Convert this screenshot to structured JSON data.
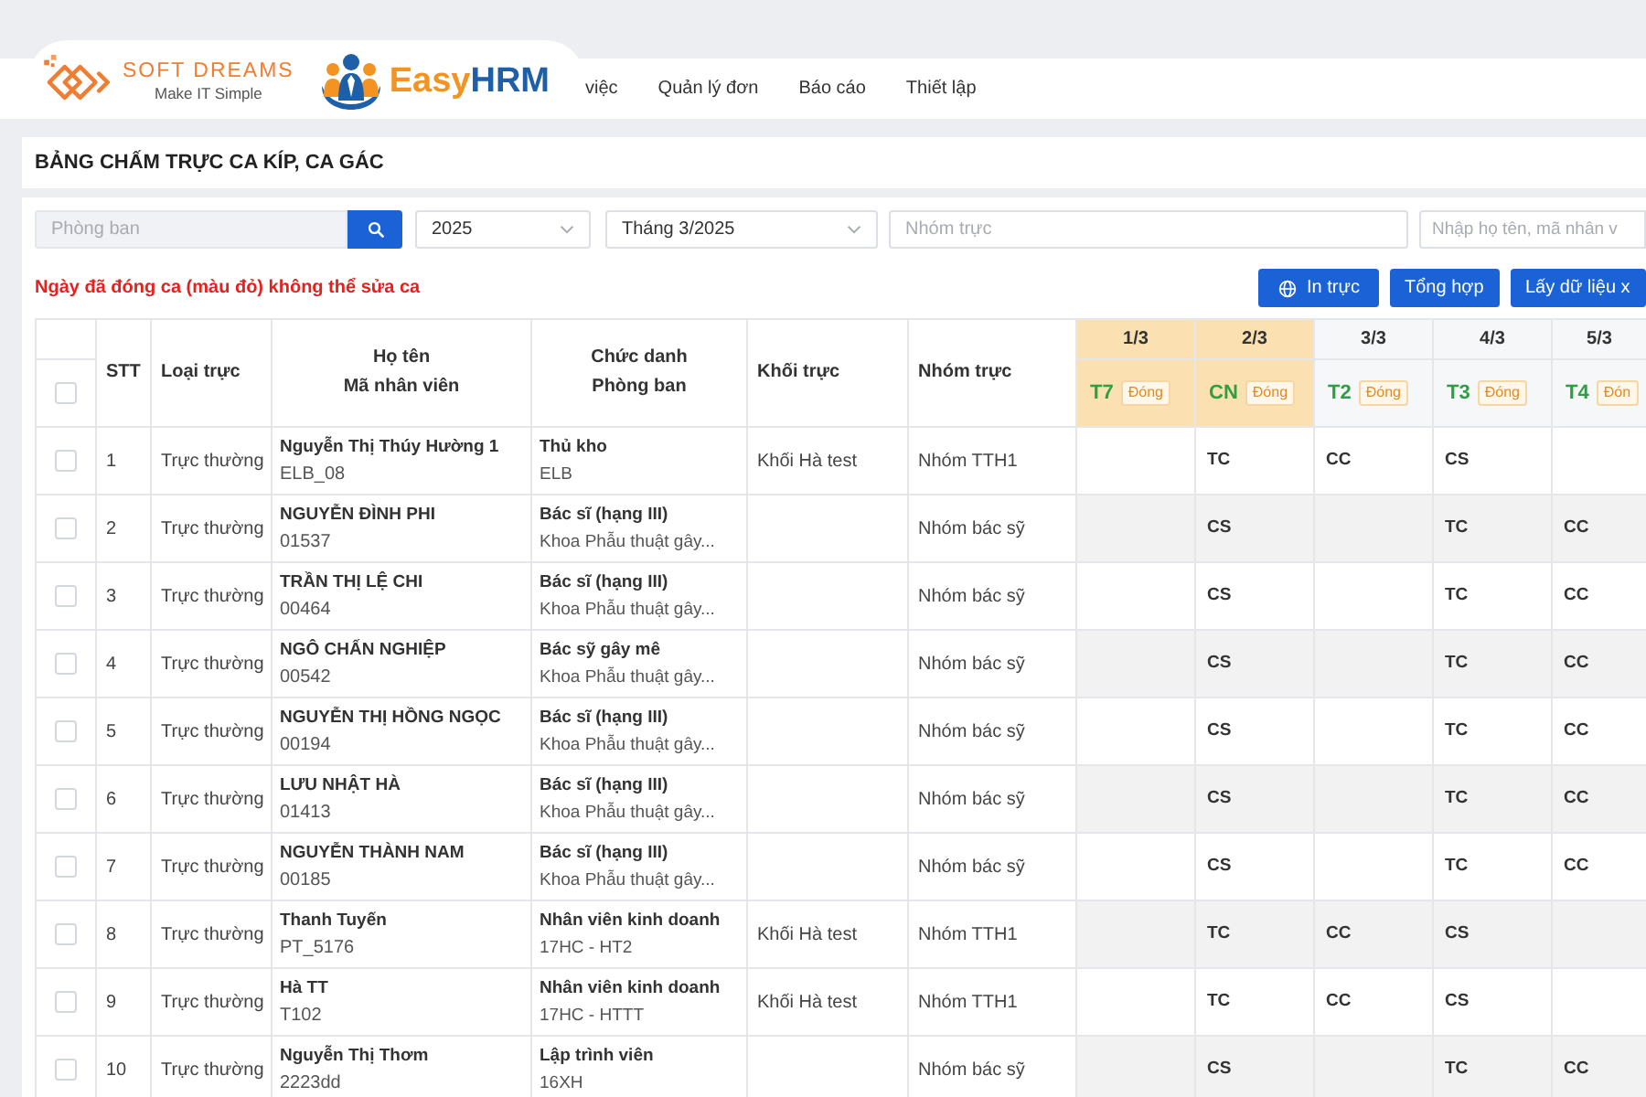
{
  "logos": {
    "company": {
      "name": "SOFT DREAMS",
      "tagline": "Make IT Simple"
    },
    "product": {
      "name_lead": "Easy",
      "name_tail": "HRM"
    }
  },
  "nav": {
    "items": [
      "việc",
      "Quản lý đơn",
      "Báo cáo",
      "Thiết lập"
    ]
  },
  "page_title": "BẢNG CHẤM TRỰC CA KÍP, CA GÁC",
  "filters": {
    "department": {
      "placeholder": "Phòng ban"
    },
    "year": {
      "value": "2025"
    },
    "month": {
      "value": "Tháng 3/2025"
    },
    "duty_group": {
      "placeholder": "Nhóm trực"
    },
    "search": {
      "placeholder": "Nhập họ tên, mã nhân v"
    }
  },
  "notice": "Ngày đã đóng ca (màu đỏ) không thể sửa ca",
  "actions": [
    {
      "kind": "icon",
      "label": "In trực"
    },
    {
      "kind": "text",
      "label": "Tổng hợp"
    },
    {
      "kind": "text",
      "label": "Lấy dữ liệu x"
    }
  ],
  "table": {
    "select_all": {
      "checked": false
    },
    "columns": [
      {
        "lines": [
          "STT"
        ]
      },
      {
        "lines": [
          "Loại trực"
        ]
      },
      {
        "lines": [
          "Họ tên",
          "Mã nhân viên"
        ]
      },
      {
        "lines": [
          "Chức danh",
          "Phòng ban"
        ]
      },
      {
        "lines": [
          "Khối trực"
        ]
      },
      {
        "lines": [
          "Nhóm trực"
        ]
      }
    ],
    "days": [
      {
        "date": "1/3",
        "weekday": "T7",
        "status": "Đóng",
        "weekend": true
      },
      {
        "date": "2/3",
        "weekday": "CN",
        "status": "Đóng",
        "weekend": true
      },
      {
        "date": "3/3",
        "weekday": "T2",
        "status": "Đóng",
        "weekend": false
      },
      {
        "date": "4/3",
        "weekday": "T3",
        "status": "Đóng",
        "weekend": false
      },
      {
        "date": "5/3",
        "weekday": "T4",
        "status": "Đón",
        "weekend": false
      }
    ],
    "rows": [
      {
        "checked": false,
        "stt": "1",
        "type": "Trực thường",
        "name": "Nguyễn Thị Thúy Hường 1",
        "code": "ELB_08",
        "title": "Thủ kho",
        "department": "ELB",
        "block": "Khối Hà test",
        "group": "Nhóm TTH1",
        "shifts": {
          "day_2": "TC",
          "day_3": "CC",
          "day_4": "CS"
        }
      },
      {
        "checked": false,
        "stt": "2",
        "type": "Trực thường",
        "name": "NGUYỄN ĐÌNH PHI",
        "code": "01537",
        "title": "Bác sĩ (hạng III)",
        "department": "Khoa Phẫu thuật gây...",
        "group": "Nhóm bác sỹ",
        "shifts": {
          "day_2": "CS",
          "day_4": "TC",
          "day_5": "CC"
        }
      },
      {
        "checked": false,
        "stt": "3",
        "type": "Trực thường",
        "name": "TRẦN THỊ LỆ CHI",
        "code": "00464",
        "title": "Bác sĩ (hạng III)",
        "department": "Khoa Phẫu thuật gây...",
        "group": "Nhóm bác sỹ",
        "shifts": {
          "day_2": "CS",
          "day_4": "TC",
          "day_5": "CC"
        }
      },
      {
        "checked": false,
        "stt": "4",
        "type": "Trực thường",
        "name": "NGÔ CHẤN NGHIỆP",
        "code": "00542",
        "title": "Bác sỹ gây mê",
        "department": "Khoa Phẫu thuật gây...",
        "group": "Nhóm bác sỹ",
        "shifts": {
          "day_2": "CS",
          "day_4": "TC",
          "day_5": "CC"
        }
      },
      {
        "checked": false,
        "stt": "5",
        "type": "Trực thường",
        "name": "NGUYỄN THỊ HỒNG NGỌC",
        "code": "00194",
        "title": "Bác sĩ (hạng III)",
        "department": "Khoa Phẫu thuật gây...",
        "group": "Nhóm bác sỹ",
        "shifts": {
          "day_2": "CS",
          "day_4": "TC",
          "day_5": "CC"
        }
      },
      {
        "checked": false,
        "stt": "6",
        "type": "Trực thường",
        "name": "LƯU NHẬT HÀ",
        "code": "01413",
        "title": "Bác sĩ (hạng III)",
        "department": "Khoa Phẫu thuật gây...",
        "group": "Nhóm bác sỹ",
        "shifts": {
          "day_2": "CS",
          "day_4": "TC",
          "day_5": "CC"
        }
      },
      {
        "checked": false,
        "stt": "7",
        "type": "Trực thường",
        "name": "NGUYỄN THÀNH NAM",
        "code": "00185",
        "title": "Bác sĩ (hạng III)",
        "department": "Khoa Phẫu thuật gây...",
        "group": "Nhóm bác sỹ",
        "shifts": {
          "day_2": "CS",
          "day_4": "TC",
          "day_5": "CC"
        }
      },
      {
        "checked": false,
        "stt": "8",
        "type": "Trực thường",
        "name": "Thanh Tuyến",
        "code": "PT_5176",
        "title": "Nhân viên kinh doanh",
        "department": "17HC - HT2",
        "block": "Khối Hà test",
        "group": "Nhóm TTH1",
        "shifts": {
          "day_2": "TC",
          "day_3": "CC",
          "day_4": "CS"
        }
      },
      {
        "checked": false,
        "stt": "9",
        "type": "Trực thường",
        "name": "Hà TT",
        "code": "T102",
        "title": "Nhân viên kinh doanh",
        "department": "17HC - HTTT",
        "block": "Khối Hà test",
        "group": "Nhóm TTH1",
        "shifts": {
          "day_2": "TC",
          "day_3": "CC",
          "day_4": "CS"
        }
      },
      {
        "checked": false,
        "stt": "10",
        "type": "Trực thường",
        "name": "Nguyễn Thị Thơm",
        "code": "2223dd",
        "title": "Lập trình viên",
        "department": "16XH",
        "group": "Nhóm bác sỹ",
        "shifts": {
          "day_2": "CS",
          "day_4": "TC",
          "day_5": "CC"
        }
      }
    ]
  }
}
